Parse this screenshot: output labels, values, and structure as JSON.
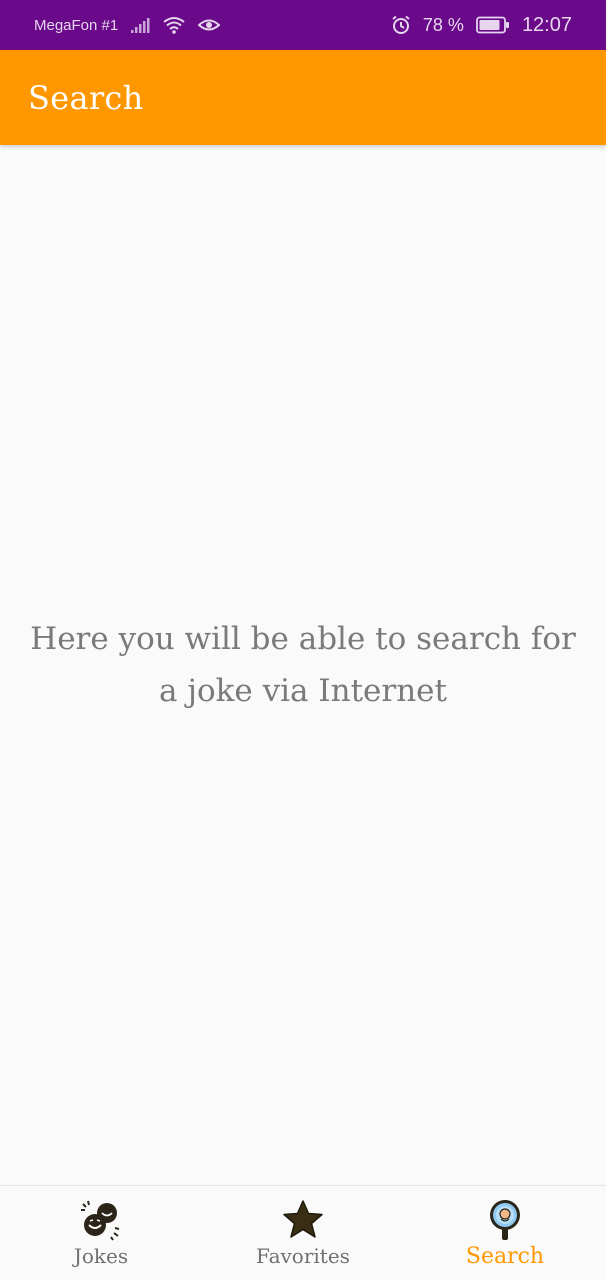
{
  "status_bar": {
    "carrier": "MegaFon #1",
    "battery_percent": "78 %",
    "time": "12:07",
    "icons": [
      "signal-icon",
      "wifi-icon",
      "eye-icon",
      "alarm-icon",
      "battery-icon"
    ]
  },
  "app_bar": {
    "title": "Search"
  },
  "content": {
    "message": "Here you will be able to search for a joke via Internet"
  },
  "bottom_nav": {
    "active_index": 2,
    "active_color": "#ff9800",
    "items": [
      {
        "label": "Jokes",
        "icon": "laughing-faces-icon"
      },
      {
        "label": "Favorites",
        "icon": "star-icon"
      },
      {
        "label": "Search",
        "icon": "magnifier-icon"
      }
    ]
  },
  "colors": {
    "status_bar": "#6a0a8a",
    "app_bar": "#ff9800",
    "background": "#fafafa"
  }
}
